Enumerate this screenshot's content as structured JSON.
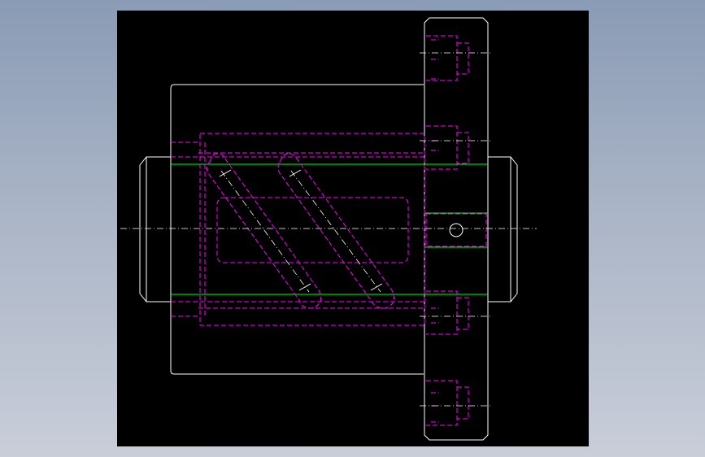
{
  "app": {
    "title": ""
  },
  "colors": {
    "background": "#000000",
    "outline": "#ffffff",
    "hidden": "#ff00ff",
    "center": "#ffffff",
    "green": "#00ff00"
  },
  "drawing": {
    "description_icon": "ball-screw-nut-with-flange",
    "layers": [
      "outline",
      "hidden-lines",
      "center-lines",
      "green-lines"
    ]
  }
}
